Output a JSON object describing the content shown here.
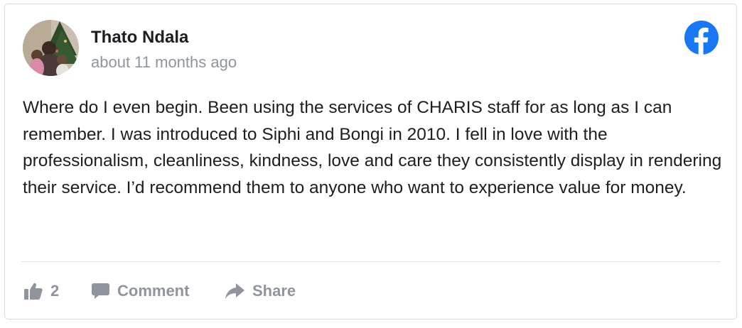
{
  "review": {
    "author_name": "Thato Ndala",
    "timestamp": "about 11 months ago",
    "platform_icon": "facebook-icon",
    "text": "Where do I even begin. Been using the services of CHARIS staff for as long as I can remember. I was introduced to Siphi and Bongi in 2010. I fell in love with the professionalism, cleanliness, kindness, love and care they consistently display in rendering their service. I’d recommend them to anyone who want to experience value for money."
  },
  "actions": {
    "like_count": "2",
    "comment_label": "Comment",
    "share_label": "Share"
  },
  "colors": {
    "facebook_blue": "#1877f2",
    "muted_gray": "#90949c",
    "text": "#1c1e21"
  }
}
